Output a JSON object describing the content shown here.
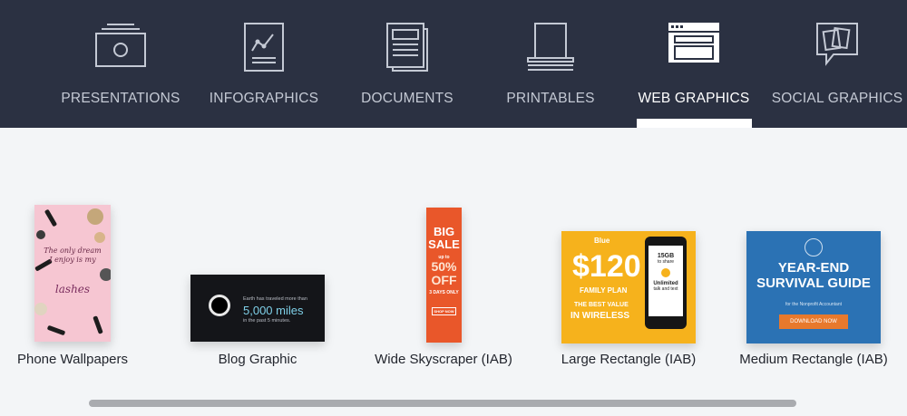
{
  "nav": {
    "tabs": [
      {
        "label": "PRESENTATIONS",
        "icon": "presentation-icon"
      },
      {
        "label": "INFOGRAPHICS",
        "icon": "infographic-chart-icon"
      },
      {
        "label": "DOCUMENTS",
        "icon": "document-icon"
      },
      {
        "label": "PRINTABLES",
        "icon": "printer-icon"
      },
      {
        "label": "WEB GRAPHICS",
        "icon": "browser-window-icon"
      },
      {
        "label": "SOCIAL GRAPHICS",
        "icon": "chat-bubble-icon"
      }
    ],
    "active_tab": "WEB GRAPHICS"
  },
  "colors": {
    "nav_bg": "#2b3142",
    "content_bg": "#f3f5f7",
    "active_text": "#ffffff",
    "inactive_text": "#c4c9d4"
  },
  "cards": [
    {
      "label": "Phone Wallpapers"
    },
    {
      "label": "Blog Graphic"
    },
    {
      "label": "Wide Skyscraper (IAB)"
    },
    {
      "label": "Large Rectangle (IAB)"
    },
    {
      "label": "Medium Rectangle (IAB)"
    }
  ],
  "thumbs": {
    "phone": {
      "script": "The only dream I enjoy is my",
      "lash": "lashes"
    },
    "blog": {
      "small": "Earth has traveled more than",
      "big": "5,000 miles",
      "small2": "in the past 5 minutes."
    },
    "sky": {
      "l1": "BIG",
      "l2": "SALE",
      "l3": "up to",
      "l4": "50%",
      "l5": "OFF",
      "l6": "3 DAYS ONLY",
      "btn": "SHOP NOW"
    },
    "large": {
      "logo": "Blue",
      "price": "$120",
      "plan": "FAMILY PLAN",
      "best": "THE BEST VALUE",
      "wire": "IN WIRELESS",
      "gb": "15GB",
      "share": "to share",
      "unl": "Unlimited",
      "talk": "talk and text"
    },
    "medium": {
      "t1": "YEAR-END",
      "t2": "SURVIVAL GUIDE",
      "t3": "for the Nonprofit Accountant",
      "dl": "DOWNLOAD NOW"
    }
  }
}
